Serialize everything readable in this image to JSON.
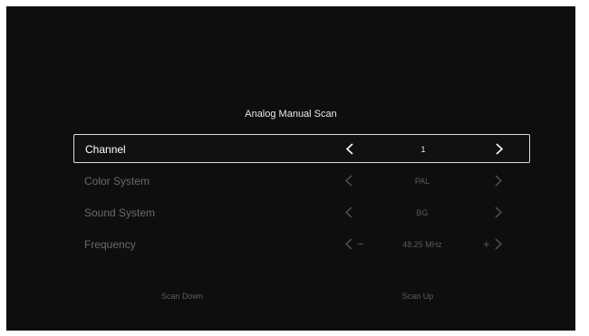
{
  "screen": {
    "title": "Analog Manual Scan"
  },
  "settings": [
    {
      "label": "Channel",
      "value": "1"
    },
    {
      "label": "Color System",
      "value": "PAL"
    },
    {
      "label": "Sound System",
      "value": "BG"
    },
    {
      "label": "Frequency",
      "value": "48.25 MHz",
      "minus": "−",
      "plus": "+"
    }
  ],
  "buttons": {
    "scan_down": "Scan Down",
    "scan_up": "Scan Up"
  },
  "icons": {
    "prev": "chevron-left-icon",
    "next": "chevron-right-icon"
  },
  "colors": {
    "background": "#0e0e0e",
    "selected_border": "#dcdcdc",
    "active_text": "#ffffff",
    "inactive_text": "#6a6a6a"
  }
}
